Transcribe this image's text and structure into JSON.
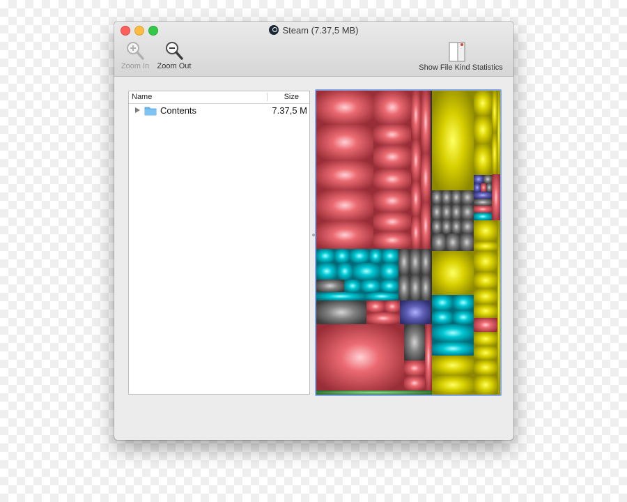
{
  "window": {
    "title": "Steam (7.37,5 MB)",
    "app_icon": "steam-icon"
  },
  "toolbar": {
    "zoom_in_label": "Zoom In",
    "zoom_out_label": "Zoom Out",
    "stats_label": "Show File Kind Statistics",
    "zoom_in_enabled": false,
    "zoom_out_enabled": true
  },
  "file_list": {
    "columns": [
      "Name",
      "Size"
    ],
    "rows": [
      {
        "name": "Contents",
        "size": "7.37,5 M",
        "icon": "folder-icon",
        "expanded": false
      }
    ]
  },
  "treemap": {
    "selected": true,
    "file_kind_colors": {
      "red": "#b8404b",
      "yellow": "#c9c000",
      "cyan": "#00b8c4",
      "gray": "#6e6e6e",
      "blue": "#5a58a8",
      "green": "#3a8a3a"
    }
  }
}
